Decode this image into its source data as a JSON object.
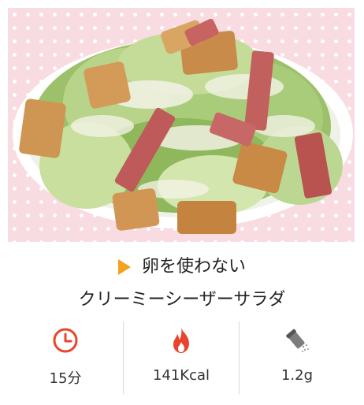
{
  "recipe": {
    "title_line1": "卵を使わない",
    "title_line2": "クリーミーシーザーサラダ"
  },
  "stats": {
    "time": {
      "icon": "clock-icon",
      "value": "15分"
    },
    "calories": {
      "icon": "flame-icon",
      "value": "141Kcal"
    },
    "salt": {
      "icon": "salt-shaker-icon",
      "value": "1.2g"
    }
  },
  "colors": {
    "accent_orange": "#f4a21d",
    "icon_red": "#e8452c",
    "background_pink": "#f8dce1"
  }
}
